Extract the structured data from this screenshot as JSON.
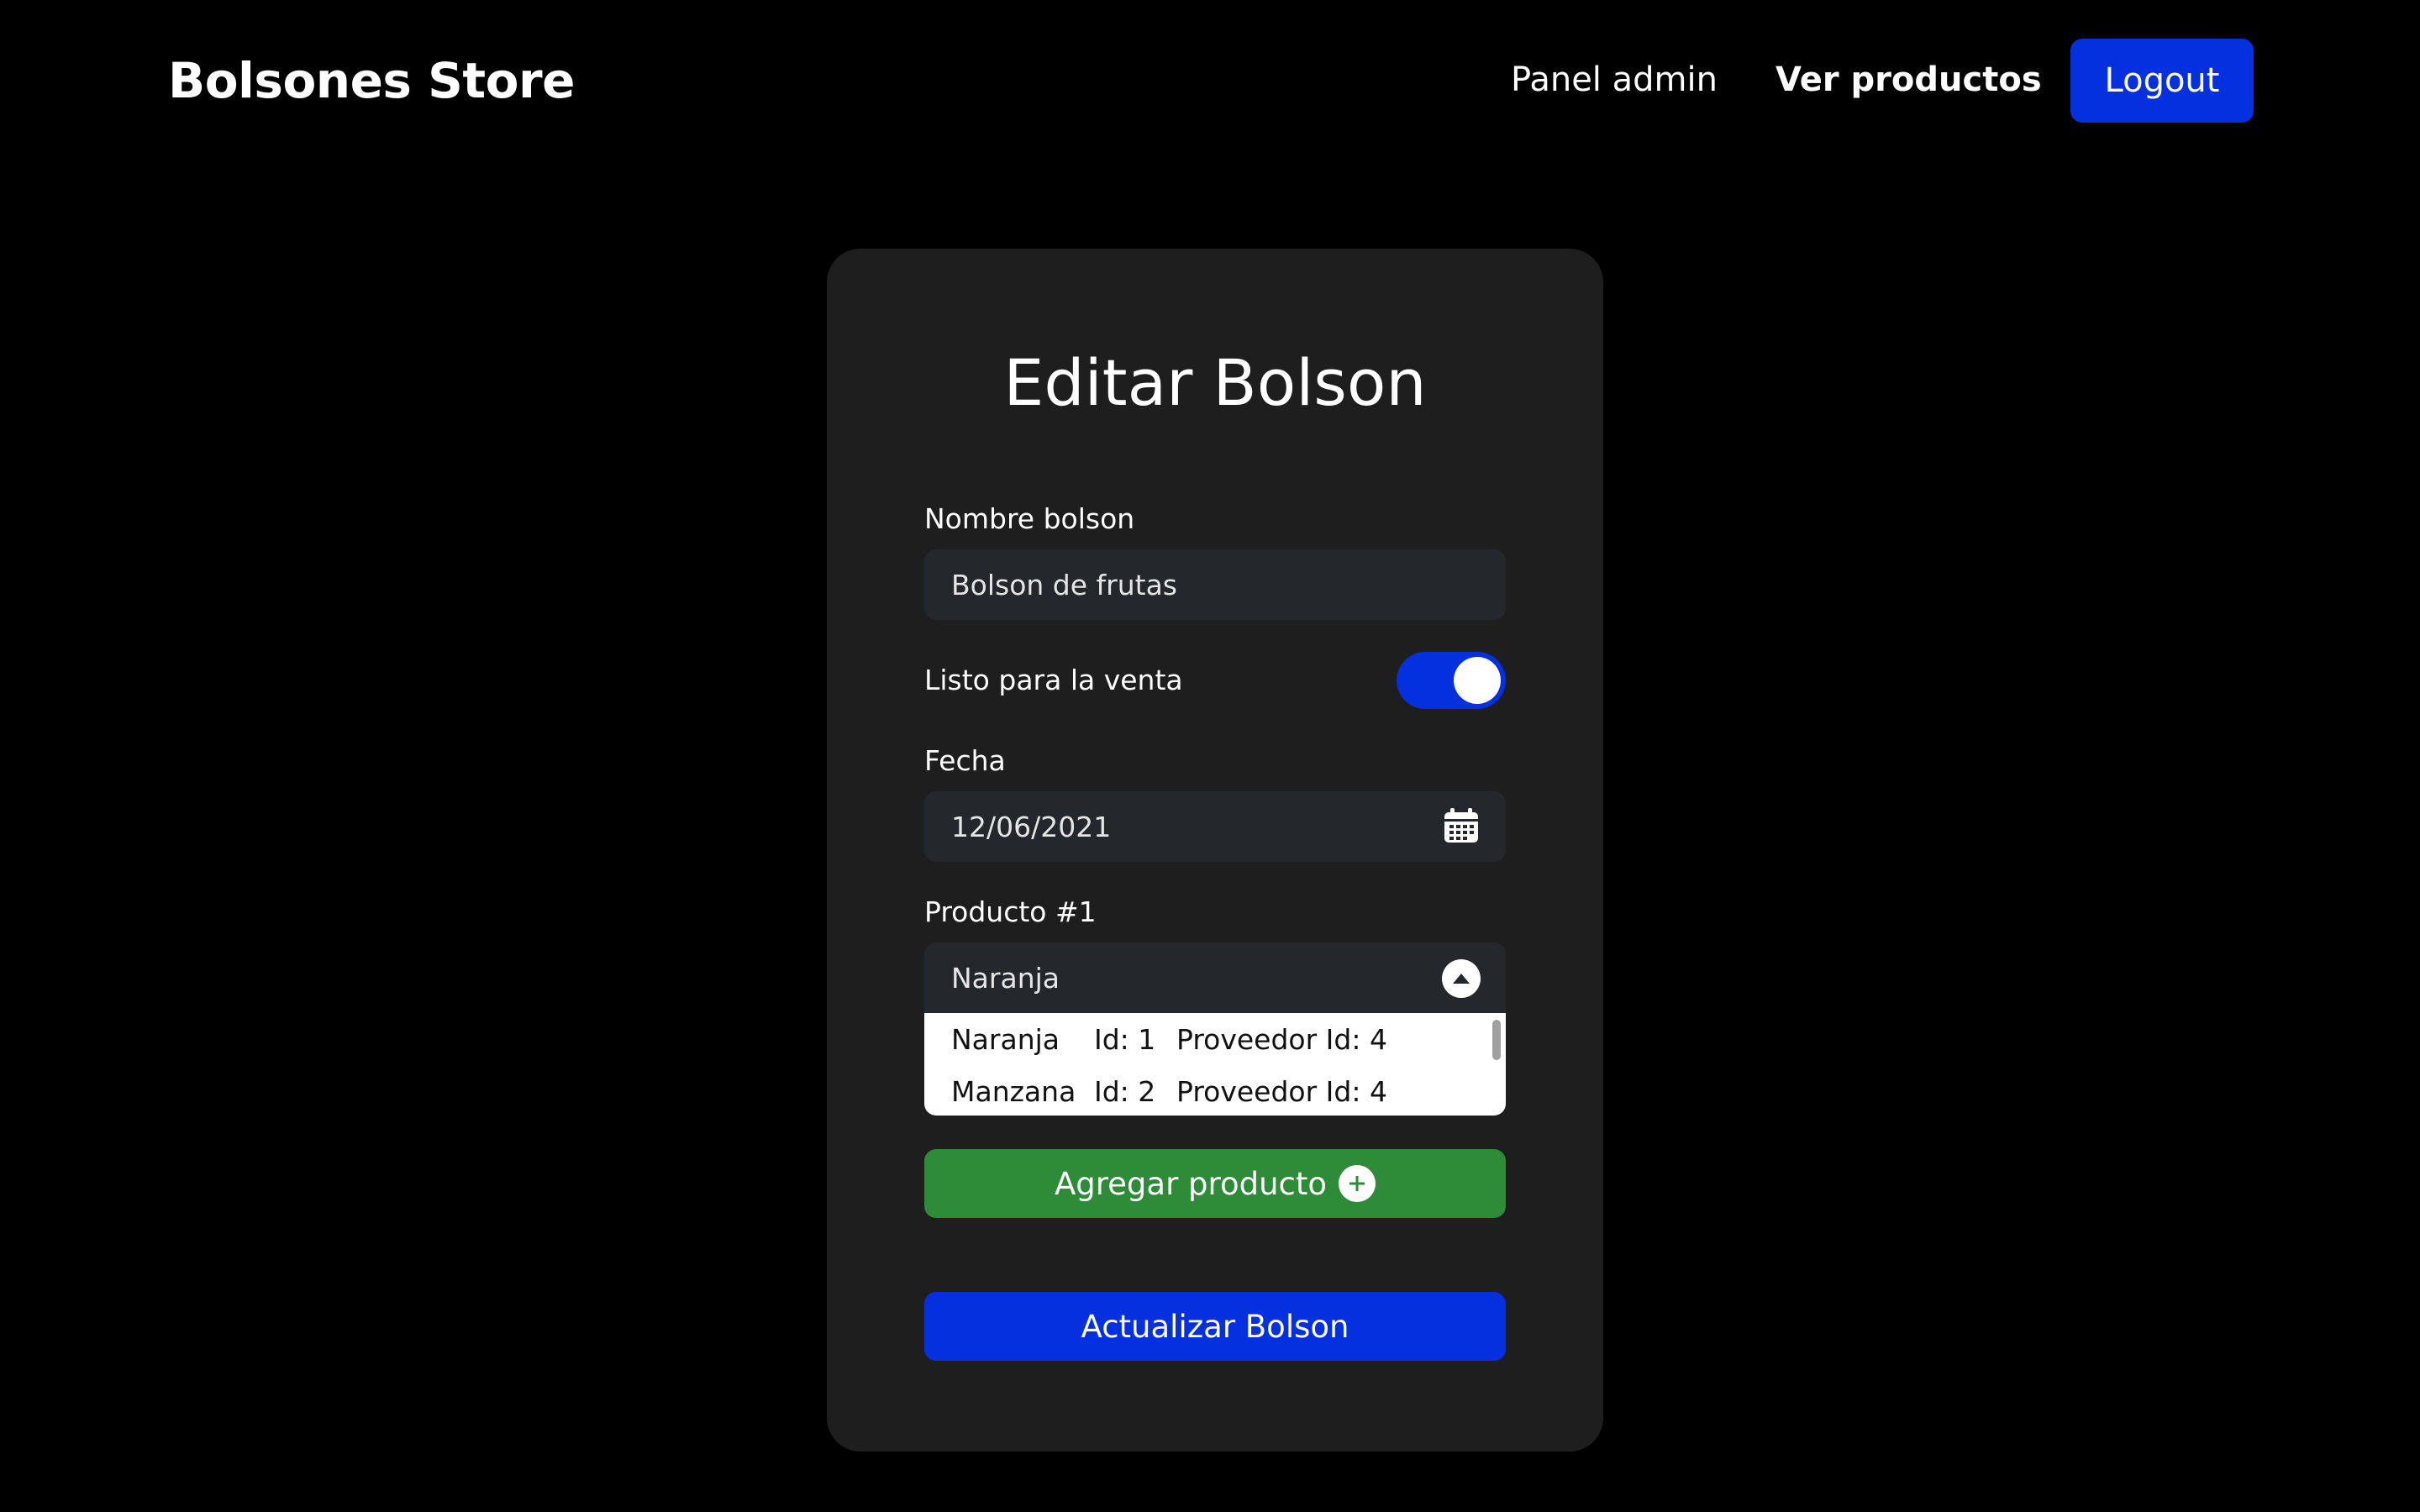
{
  "navbar": {
    "brand": "Bolsones Store",
    "links": [
      "Panel admin",
      "Ver productos"
    ],
    "logout_label": "Logout"
  },
  "form": {
    "title": "Editar Bolson",
    "nombre": {
      "label": "Nombre bolson",
      "value": "Bolson de frutas"
    },
    "listo": {
      "label": "Listo para la venta",
      "checked": true
    },
    "fecha": {
      "label": "Fecha",
      "value": "12/06/2021",
      "icon": "calendar-icon"
    },
    "producto": {
      "label": "Producto #1",
      "selected": "Naranja",
      "icon": "chevron-up-icon",
      "options": [
        {
          "name": "Naranja",
          "id": "Id: 1",
          "proveedor": "Proveedor Id: 4"
        },
        {
          "name": "Manzana",
          "id": "Id: 2",
          "proveedor": "Proveedor Id: 4"
        }
      ]
    },
    "add_label": "Agregar producto",
    "update_label": "Actualizar Bolson"
  },
  "colors": {
    "background": "#000000",
    "card": "#1e1e1f",
    "primary": "#0430e0",
    "success": "#2e8b38"
  }
}
